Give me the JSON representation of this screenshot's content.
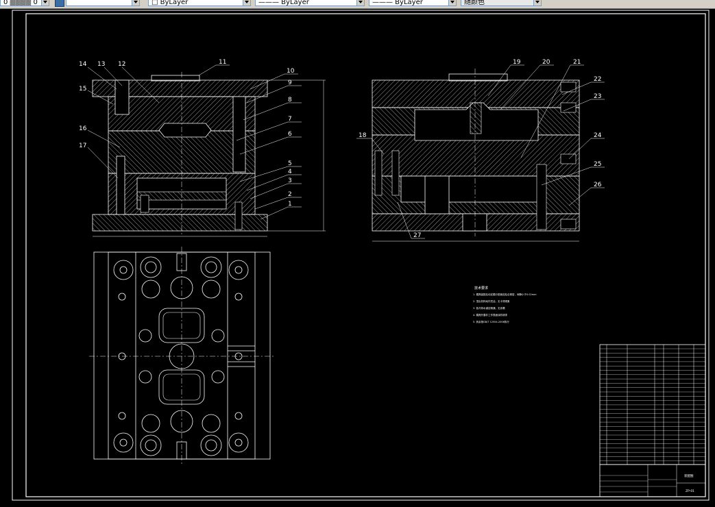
{
  "toolbar": {
    "layer_field": "0 ▒▒▒▒ 0",
    "color_field": "□ ByLayer",
    "linetype_field": "——— ByLayer",
    "lineweight_field": "——— ByLayer",
    "plotstyle_field": "随颜色"
  },
  "drawing": {
    "part_numbers_left": [
      "1",
      "2",
      "3",
      "4",
      "5",
      "6",
      "7",
      "8",
      "9",
      "10",
      "11",
      "12",
      "13",
      "14",
      "15",
      "16",
      "17"
    ],
    "part_numbers_right": [
      "18",
      "19",
      "20",
      "21",
      "22",
      "23",
      "24",
      "25",
      "26",
      "27"
    ],
    "tech_notes_title": "技术要求",
    "tech_notes": [
      "1. 模具装配后动定模分型面应贴合紧密，间隙小于0.02mm",
      "2. 顶出机构动作灵活，无卡滞现象",
      "3. 各冷却水道应畅通，无渗漏",
      "4. 模具外露非工作表面涂防锈漆",
      "5. 其余按GB/T 12554-2006执行"
    ],
    "title_block_name": "装配图",
    "title_block_code": "ZP-01"
  },
  "colors": {
    "background": "#000000",
    "lines": "#ffffff",
    "frame": "#ffffff"
  }
}
